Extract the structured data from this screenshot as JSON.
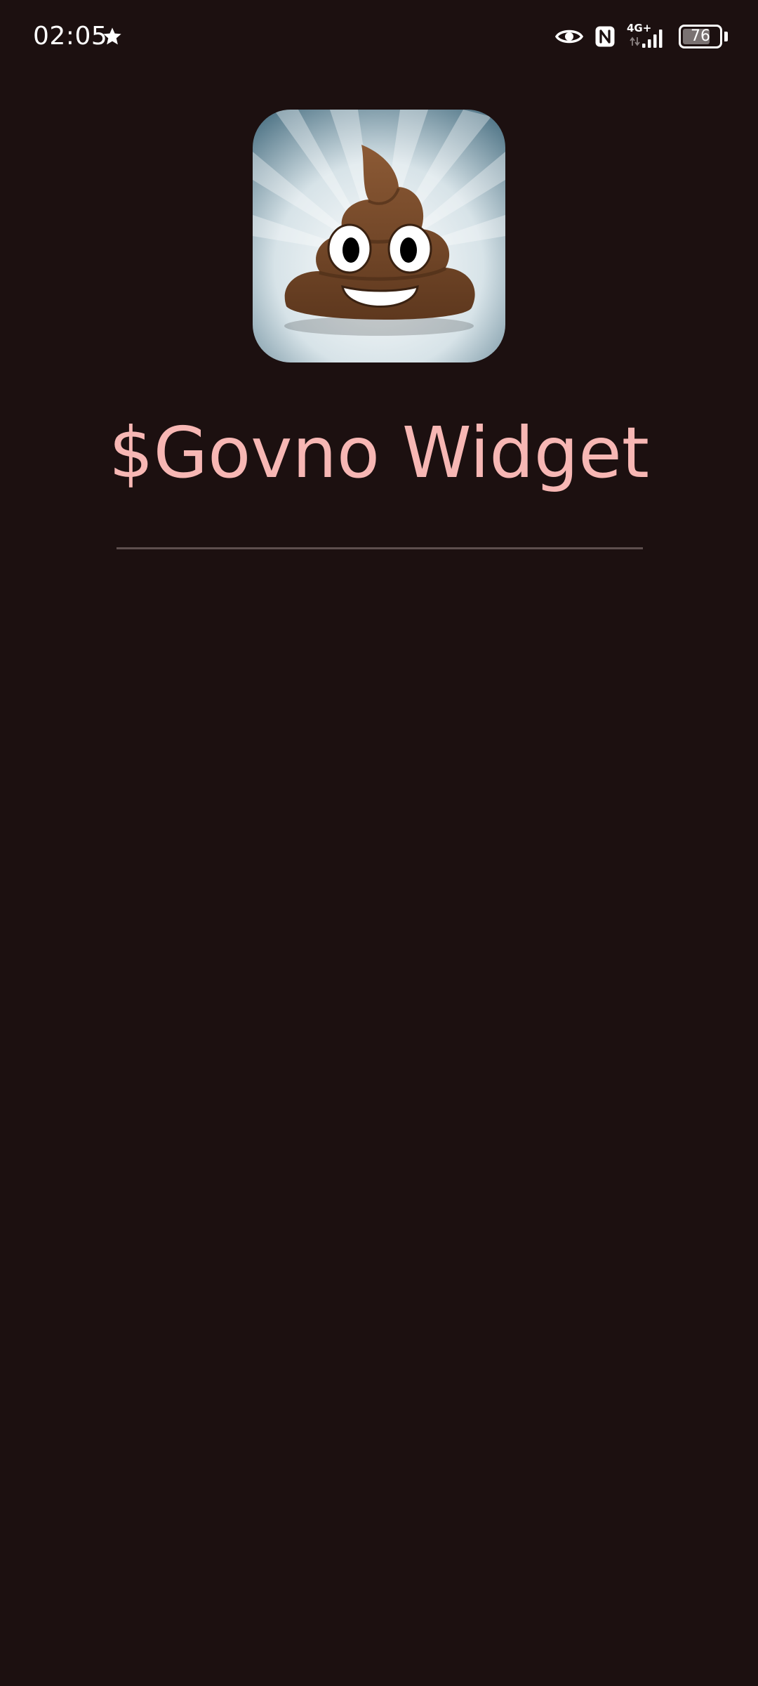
{
  "status_bar": {
    "time": "02:05",
    "network_label": "4G+",
    "battery_level": "76",
    "battery_fraction": 0.76,
    "icons": [
      "star-icon",
      "eye-icon",
      "nfc-icon",
      "signal-icon",
      "battery-icon"
    ]
  },
  "app": {
    "icon_name": "pile-of-poo-icon",
    "title": "$Govno Widget"
  },
  "colors": {
    "background": "#1c1010",
    "title": "#f7b7b4",
    "divider": "#5e4f4e"
  }
}
